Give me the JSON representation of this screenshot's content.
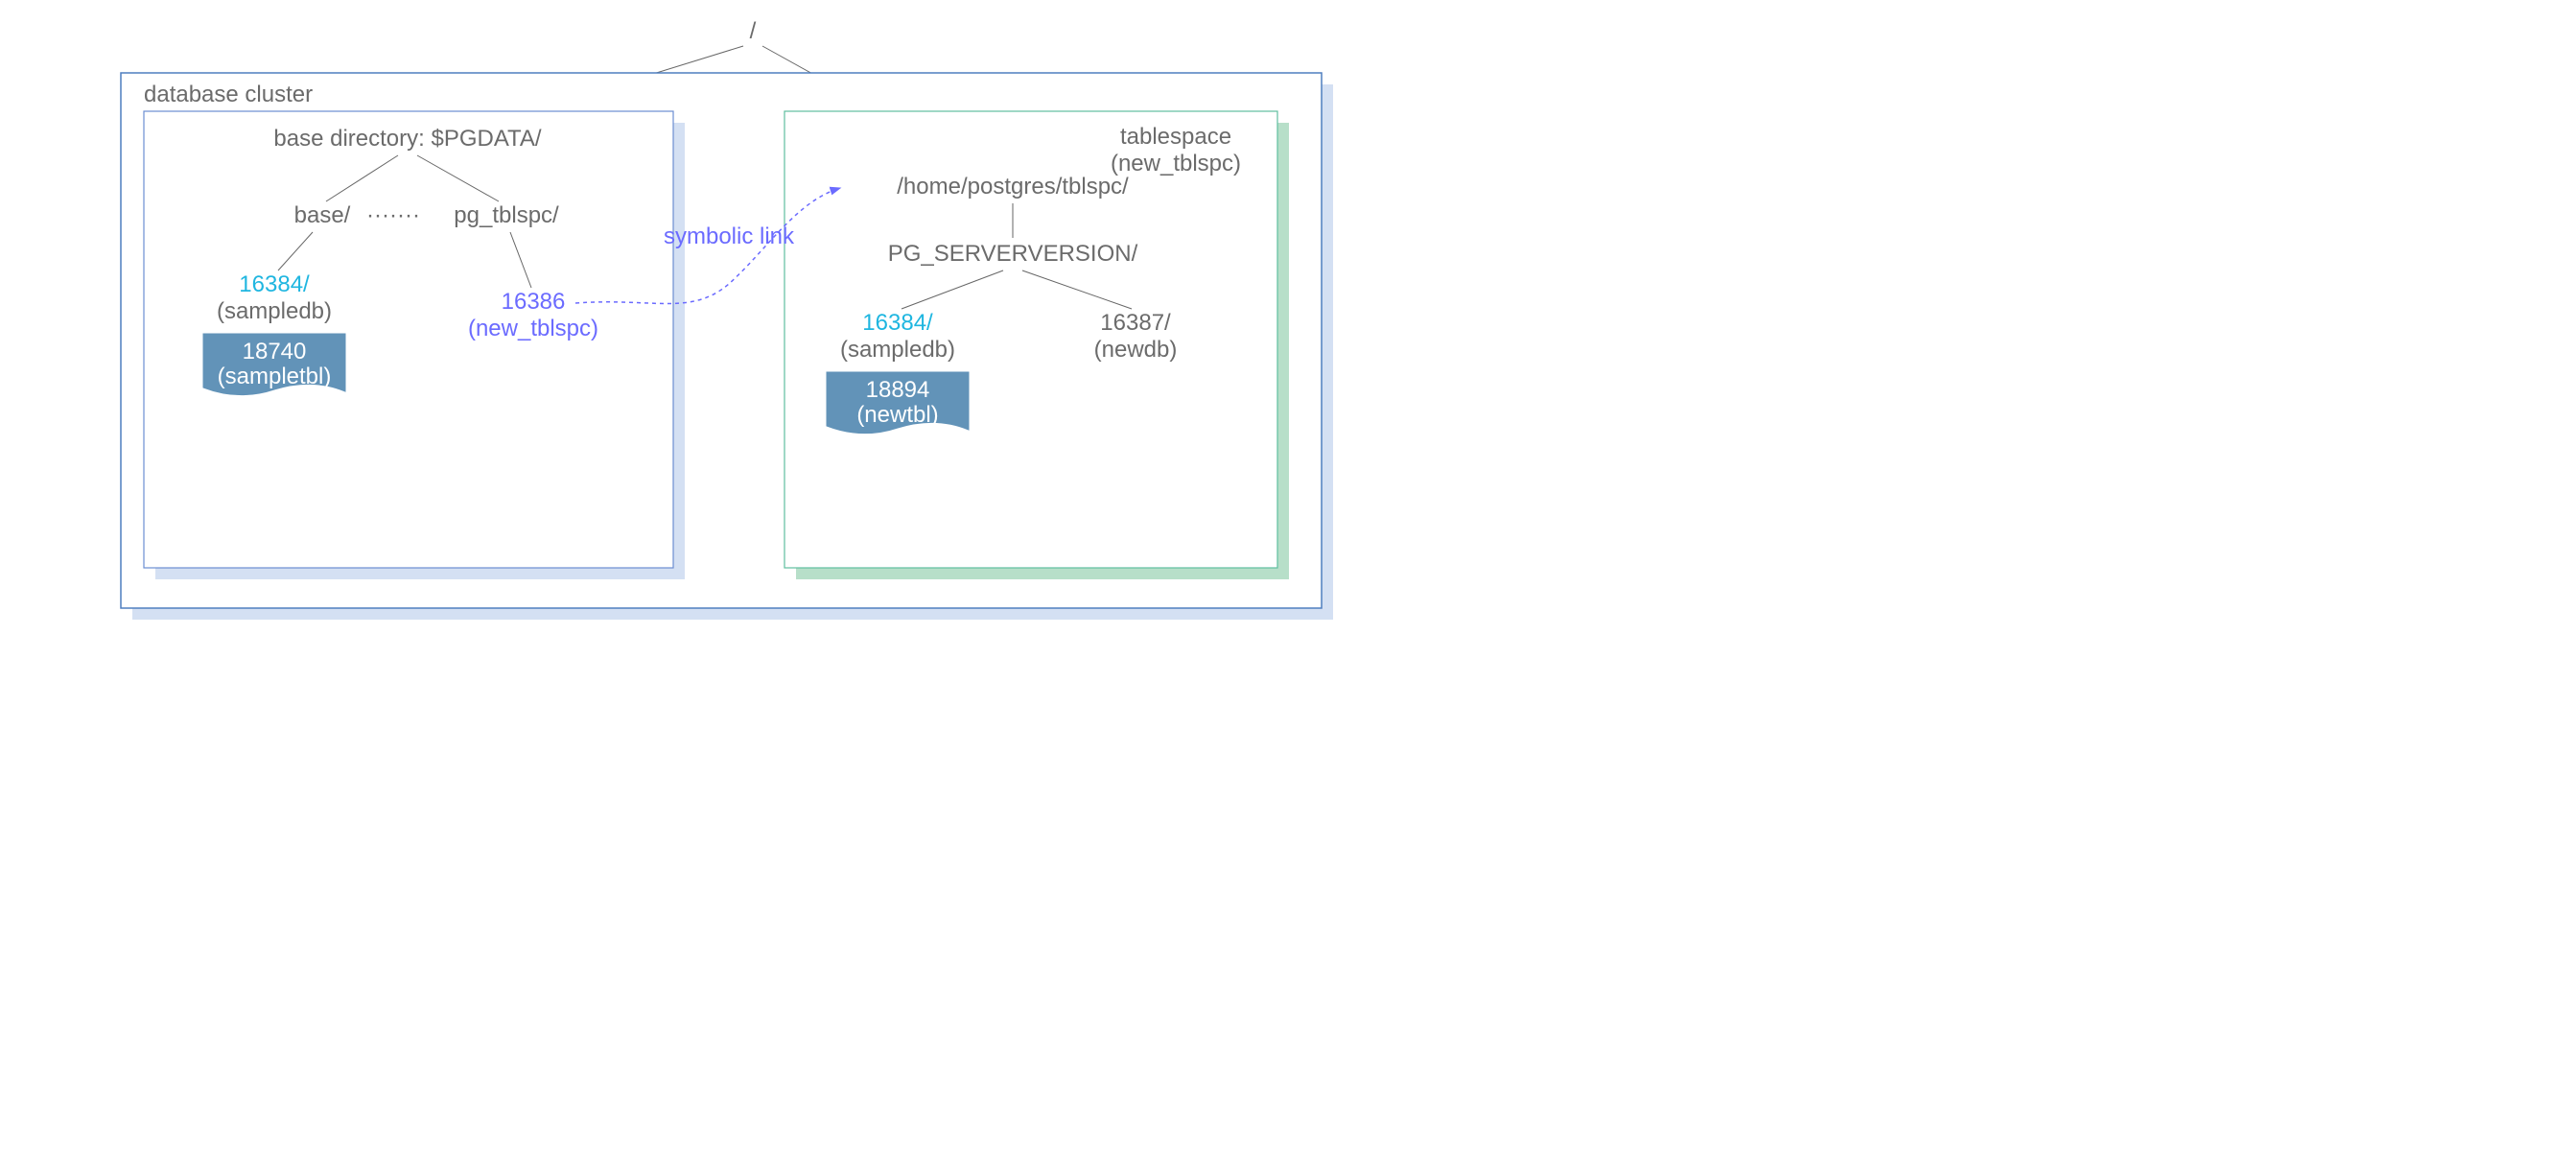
{
  "root": "/",
  "cluster_label": "database cluster",
  "base_dir_label": "base directory: $PGDATA/",
  "base_folder": "base/",
  "dots": "·······",
  "pg_tblspc_folder": "pg_tblspc/",
  "sampledb_oid": "16384/",
  "sampledb_name": "(sampledb)",
  "sampletbl_oid": "18740",
  "sampletbl_name": "(sampletbl)",
  "tblspc_link_oid": "16386",
  "tblspc_link_name": "(new_tblspc)",
  "symlink_label": "symbolic link",
  "tablespace_title": "tablespace",
  "tablespace_subtitle": "(new_tblspc)",
  "tblspc_path": "/home/postgres/tblspc/",
  "serverversion": "PG_SERVERVERSION/",
  "ts_sampledb_oid": "16384/",
  "ts_sampledb_name": "(sampledb)",
  "newdb_oid": "16387/",
  "newdb_name": "(newdb)",
  "newtbl_oid": "18894",
  "newtbl_name": "(newtbl)",
  "colors": {
    "gray": "#6b6b6b",
    "cyan": "#1fb6e0",
    "purple": "#6b6bff",
    "cluster_border": "#4f7fbf",
    "base_border": "#6c8ed1",
    "tbls_border": "#5fbf9f",
    "shadow_blue": "#d4e0f3",
    "shadow_green": "#b7dfc9",
    "file_fill": "#6293b8"
  }
}
